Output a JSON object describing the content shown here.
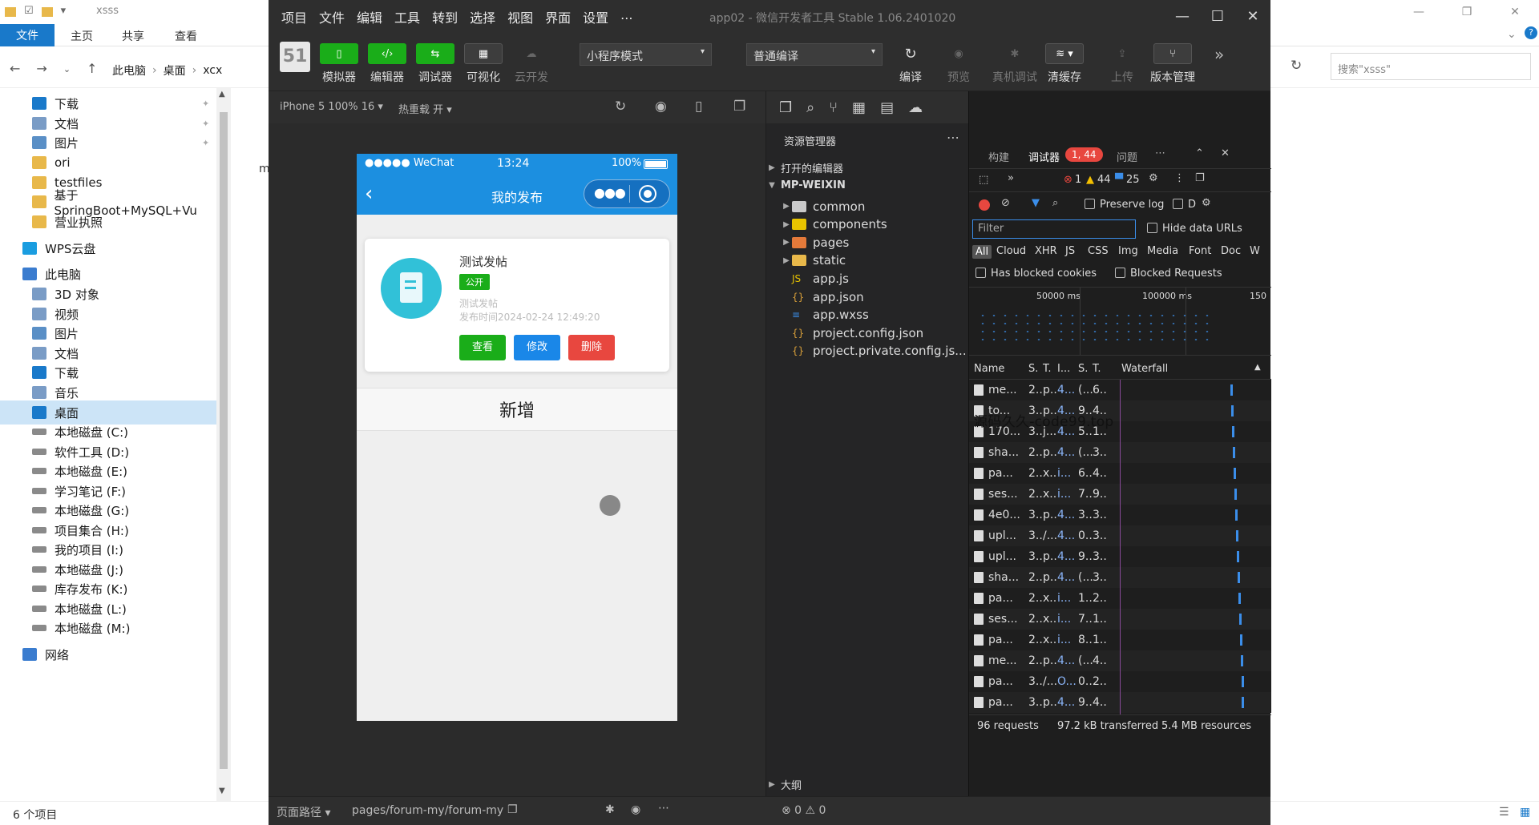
{
  "explorer": {
    "title": "xsss",
    "ribbon": {
      "file_tab": "文件",
      "tabs": [
        "主页",
        "共享",
        "查看"
      ]
    },
    "breadcrumbs": [
      "此电脑",
      "桌面",
      "xcx"
    ],
    "search_placeholder": "搜索\"xsss\"",
    "partial_header_text": "m",
    "sidebar": [
      {
        "label": "下载",
        "pinned": true
      },
      {
        "label": "文档",
        "pinned": true
      },
      {
        "label": "图片",
        "pinned": true
      },
      {
        "label": "ori"
      },
      {
        "label": "testfiles"
      },
      {
        "label": "基于SpringBoot+MySQL+Vu"
      },
      {
        "label": "营业执照"
      },
      {
        "label": "WPS云盘"
      },
      {
        "label": "此电脑"
      },
      {
        "label": "3D 对象"
      },
      {
        "label": "视频"
      },
      {
        "label": "图片"
      },
      {
        "label": "文档"
      },
      {
        "label": "下载"
      },
      {
        "label": "音乐"
      },
      {
        "label": "桌面",
        "selected": true
      },
      {
        "label": "本地磁盘 (C:)"
      },
      {
        "label": "软件工具 (D:)"
      },
      {
        "label": "本地磁盘 (E:)"
      },
      {
        "label": "学习笔记 (F:)"
      },
      {
        "label": "本地磁盘 (G:)"
      },
      {
        "label": "项目集合 (H:)"
      },
      {
        "label": "我的项目 (I:)"
      },
      {
        "label": "本地磁盘 (J:)"
      },
      {
        "label": "库存发布 (K:)"
      },
      {
        "label": "本地磁盘 (L:)"
      },
      {
        "label": "本地磁盘 (M:)"
      },
      {
        "label": "网络"
      }
    ],
    "status": "6 个项目"
  },
  "devtools": {
    "menu": [
      "项目",
      "文件",
      "编辑",
      "工具",
      "转到",
      "选择",
      "视图",
      "界面",
      "设置",
      "..."
    ],
    "window_title": "app02 - 微信开发者工具 Stable 1.06.2401020",
    "toolbar": {
      "left_buttons": [
        {
          "label": "模拟器",
          "icon": "phone-icon"
        },
        {
          "label": "编辑器",
          "icon": "code-icon"
        },
        {
          "label": "调试器",
          "icon": "debug-icon"
        },
        {
          "label": "可视化",
          "icon": "layout-icon"
        },
        {
          "label": "云开发",
          "icon": "cloud-icon"
        }
      ],
      "mode_select": "小程序模式",
      "compile_select": "普通编译",
      "right_buttons": [
        "编译",
        "预览",
        "真机调试",
        "清缓存",
        "上传",
        "版本管理"
      ]
    },
    "simulator": {
      "device": "iPhone 5 100% 16 ▾",
      "hot_reload": "热重载 开 ▾",
      "phone": {
        "carrier": "●●●●● WeChat",
        "time": "13:24",
        "battery": "100%",
        "nav_title": "我的发布",
        "card": {
          "title": "测试发帖",
          "badge": "公开",
          "content": "测试发帖",
          "time": "发布时间2024-02-24 12:49:20",
          "buttons": {
            "view": "查看",
            "edit": "修改",
            "delete": "删除"
          }
        },
        "add_label": "新增"
      }
    },
    "watermark": "源码久久-code99.top",
    "explorer_panel": {
      "title": "资源管理器",
      "open_editors": "打开的编辑器",
      "root": "MP-WEIXIN",
      "items": [
        {
          "name": "common",
          "type": "folder"
        },
        {
          "name": "components",
          "type": "folder"
        },
        {
          "name": "pages",
          "type": "folder"
        },
        {
          "name": "static",
          "type": "folder"
        },
        {
          "name": "app.js",
          "type": "js"
        },
        {
          "name": "app.json",
          "type": "json"
        },
        {
          "name": "app.wxss",
          "type": "wxss"
        },
        {
          "name": "project.config.json",
          "type": "json"
        },
        {
          "name": "project.private.config.js...",
          "type": "json"
        }
      ],
      "outline": "大纲"
    },
    "debugger": {
      "tabs": [
        "构建",
        "调试器",
        "问题"
      ],
      "badge": "1, 44",
      "counts": {
        "errors": "1",
        "warnings": "44",
        "messages": "25"
      },
      "preserve_log": "Preserve log",
      "disable_cache": "D",
      "filter_placeholder": "Filter",
      "hide_data_urls": "Hide data URLs",
      "types": [
        "All",
        "Cloud",
        "XHR",
        "JS",
        "CSS",
        "Img",
        "Media",
        "Font",
        "Doc",
        "W"
      ],
      "has_blocked_cookies": "Has blocked cookies",
      "blocked_requests": "Blocked Requests",
      "timeline_ticks": [
        "50000 ms",
        "100000 ms",
        "150"
      ],
      "columns": [
        "Name",
        "S.",
        "T.",
        "I...",
        "S.",
        "T.",
        "Waterfall"
      ],
      "rows": [
        [
          "me...",
          "2..",
          "p..",
          "4...",
          "(...",
          "6.."
        ],
        [
          "to...",
          "3..",
          "p..",
          "4...",
          "9..",
          "4.."
        ],
        [
          "170...",
          "3..",
          "j...",
          "4...",
          "5..",
          "1.."
        ],
        [
          "sha...",
          "2..",
          "p..",
          "4...",
          "(...",
          "3.."
        ],
        [
          "pa...",
          "2..",
          "x..",
          "i...",
          "6..",
          "4.."
        ],
        [
          "ses...",
          "2..",
          "x..",
          "i...",
          "7..",
          "9.."
        ],
        [
          "4e0...",
          "3..",
          "p..",
          "4...",
          "3..",
          "3.."
        ],
        [
          "upl...",
          "3..",
          "/...",
          "4...",
          "0..",
          "3.."
        ],
        [
          "upl...",
          "3..",
          "p..",
          "4...",
          "9..",
          "3.."
        ],
        [
          "sha...",
          "2..",
          "p..",
          "4...",
          "(...",
          "3.."
        ],
        [
          "pa...",
          "2..",
          "x..",
          "i...",
          "1..",
          "2.."
        ],
        [
          "ses...",
          "2..",
          "x..",
          "i...",
          "7..",
          "1.."
        ],
        [
          "pa...",
          "2..",
          "x..",
          "i...",
          "8..",
          "1.."
        ],
        [
          "me...",
          "2..",
          "p..",
          "4...",
          "(...",
          "4.."
        ],
        [
          "pa...",
          "3..",
          "/...",
          "O...",
          "0..",
          "2.."
        ],
        [
          "pa...",
          "3..",
          "p..",
          "4...",
          "9..",
          "4.."
        ]
      ],
      "summary": {
        "requests": "96 requests",
        "transferred": "97.2 kB transferred",
        "resources": "5.4 MB resources"
      }
    },
    "bottom": {
      "path_label": "页面路径 ▾",
      "path": "pages/forum-my/forum-my",
      "problems": "⊗ 0 ⚠ 0"
    }
  },
  "colors": {
    "accent_green": "#1aad19",
    "nav_blue": "#1c8fe0",
    "edit_blue": "#1a87e8",
    "delete_red": "#e8473f",
    "error_red": "#e8473f"
  }
}
